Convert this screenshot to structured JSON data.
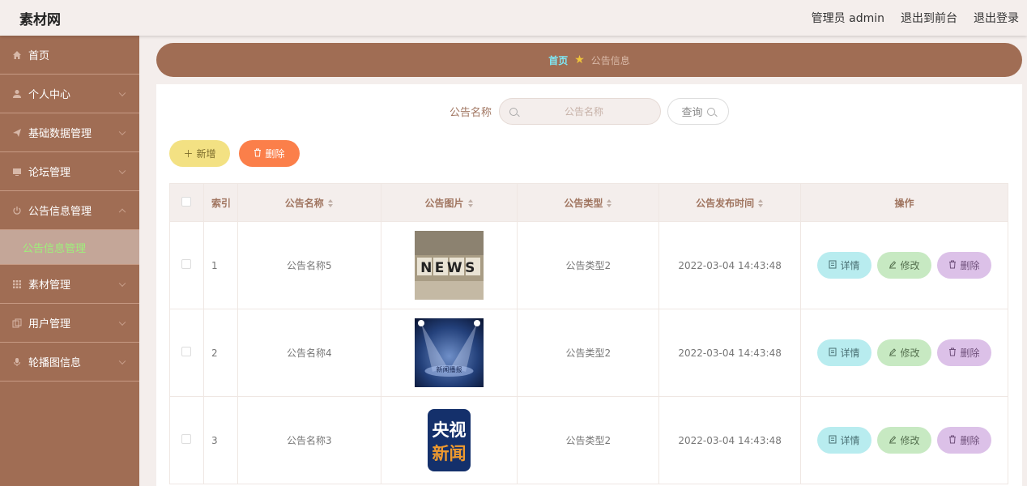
{
  "header": {
    "brand": "素材网",
    "admin_label": "管理员 admin",
    "front_label": "退出到前台",
    "logout_label": "退出登录"
  },
  "sidebar": {
    "items": [
      {
        "label": "首页",
        "icon": "home-icon"
      },
      {
        "label": "个人中心",
        "icon": "user-icon"
      },
      {
        "label": "基础数据管理",
        "icon": "send-icon"
      },
      {
        "label": "论坛管理",
        "icon": "monitor-icon"
      },
      {
        "label": "公告信息管理",
        "icon": "power-icon"
      },
      {
        "label": "素材管理",
        "icon": "grid-icon"
      },
      {
        "label": "用户管理",
        "icon": "copy-icon"
      },
      {
        "label": "轮播图信息",
        "icon": "mic-icon"
      }
    ],
    "submenu": {
      "label": "公告信息管理"
    }
  },
  "breadcrumb": {
    "home": "首页",
    "current": "公告信息"
  },
  "search": {
    "label": "公告名称",
    "placeholder": "公告名称",
    "button": "查询"
  },
  "actions": {
    "add": "新增",
    "delete": "删除"
  },
  "table": {
    "headers": {
      "index": "索引",
      "name": "公告名称",
      "image": "公告图片",
      "type": "公告类型",
      "time": "公告发布时间",
      "ops": "操作"
    },
    "rows": [
      {
        "index": "1",
        "name": "公告名称5",
        "type": "公告类型2",
        "time": "2022-03-04 14:43:48",
        "image_text": "NEWS"
      },
      {
        "index": "2",
        "name": "公告名称4",
        "type": "公告类型2",
        "time": "2022-03-04 14:43:48",
        "image_text": "新闻播报"
      },
      {
        "index": "3",
        "name": "公告名称3",
        "type": "公告类型2",
        "time": "2022-03-04 14:43:48",
        "image_text_top": "央视",
        "image_text_bottom": "新闻"
      }
    ],
    "op_labels": {
      "detail": "详情",
      "edit": "修改",
      "delete": "删除"
    }
  }
}
